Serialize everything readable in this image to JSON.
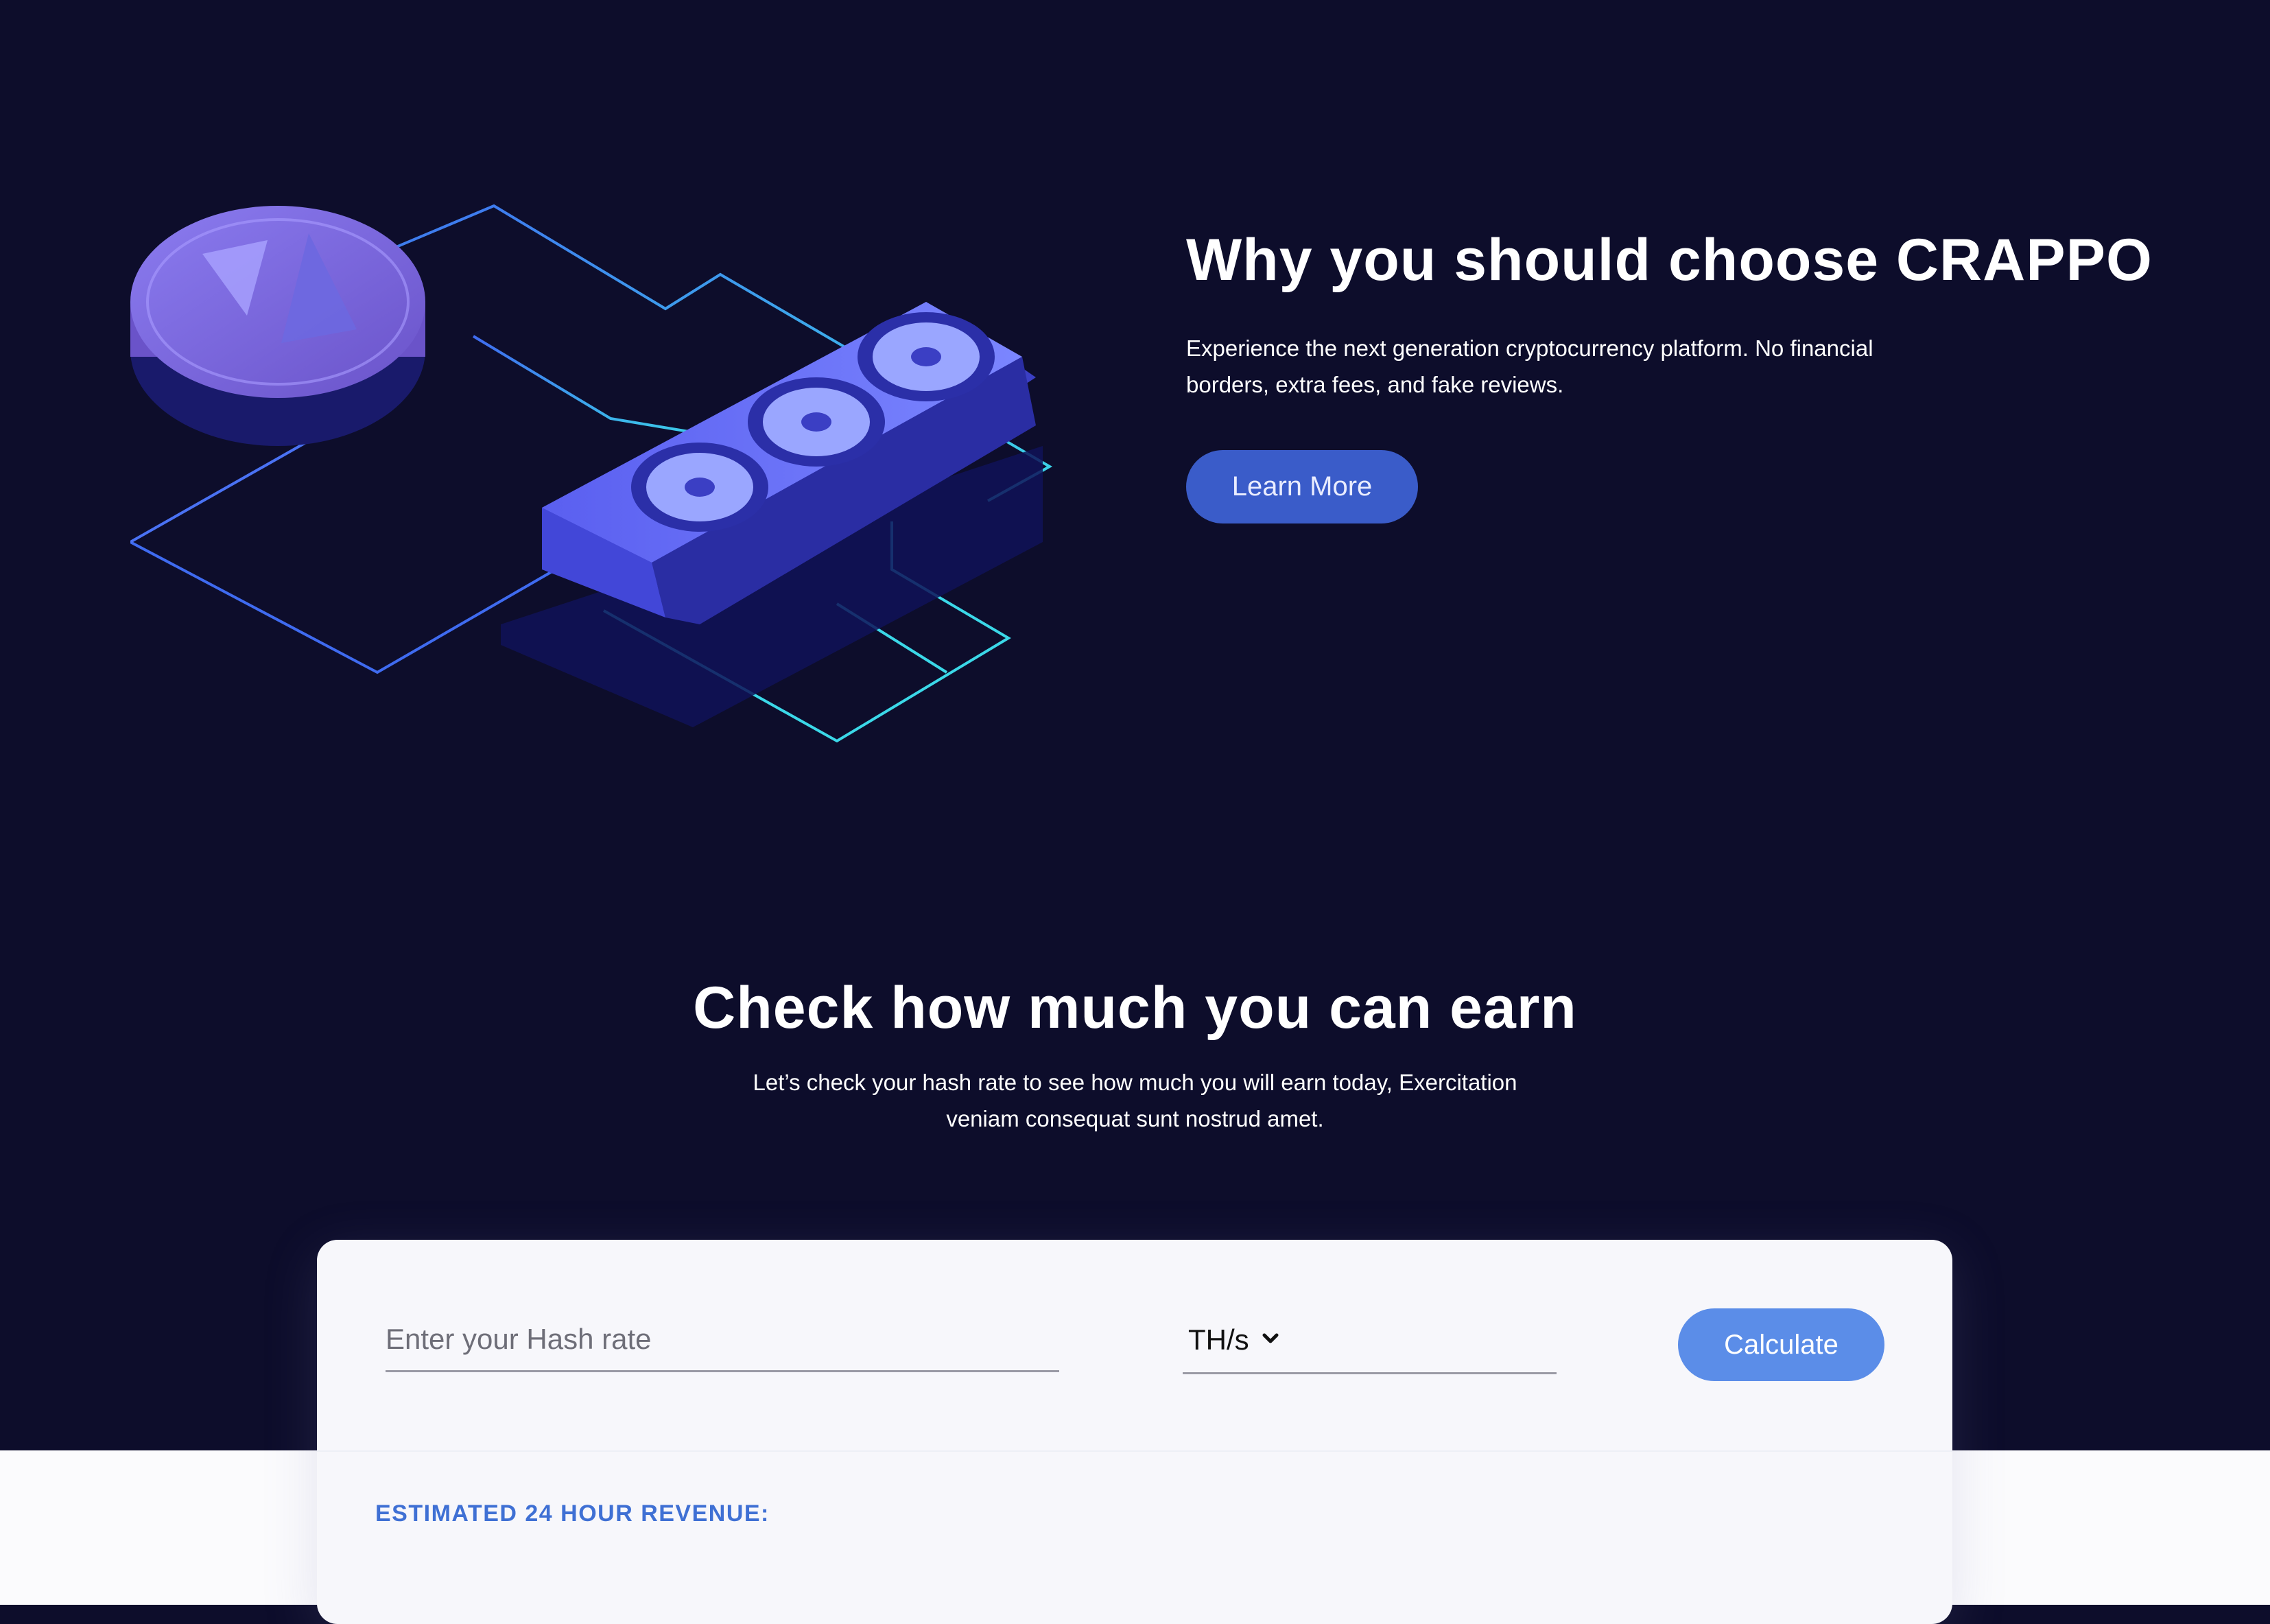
{
  "hero": {
    "title": "Why you should choose CRAPPO",
    "description": "Experience the next generation cryptocurrency platform. No financial borders, extra fees, and fake reviews.",
    "learn_more_label": "Learn More"
  },
  "earn": {
    "title": "Check how much you can earn",
    "description": "Let’s check your hash rate to see how much you will earn today, Exercitation veniam consequat sunt nostrud amet."
  },
  "calculator": {
    "hash_placeholder": "Enter your Hash rate",
    "unit_selected": "TH/s",
    "calculate_label": "Calculate",
    "revenue_label": "ESTIMATED 24 HOUR REVENUE:"
  },
  "colors": {
    "background_dark": "#0d0d2b",
    "button_learn": "#3a5cc9",
    "button_calculate": "#5b8de8",
    "revenue_accent": "#3f70d4"
  },
  "icons": {
    "illustration": "gpu-mining-coin-illustration",
    "select_arrow": "chevron-down-icon"
  }
}
